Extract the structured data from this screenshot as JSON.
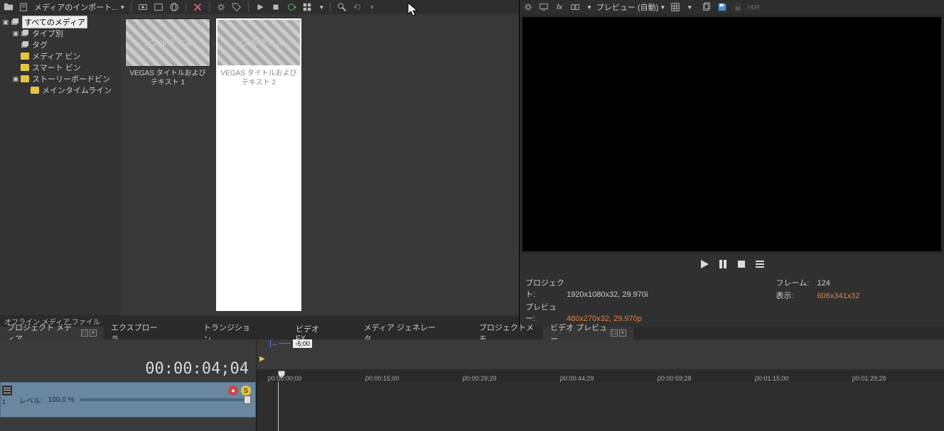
{
  "toolbar": {
    "import_label": "メディアのインポート..."
  },
  "tree": {
    "all_media": "すべてのメディア",
    "by_type": "タイプ別",
    "tags": "タグ",
    "media_bin": "メディア ビン",
    "smart_bin": "スマート ビン",
    "storyboard_bin": "ストーリーボードビン",
    "main_timeline": "メインタイムライン"
  },
  "media": {
    "items": [
      {
        "thumb_text": "ンプル テキス",
        "caption": "VEGAS タイトルおよびテキスト 1"
      },
      {
        "thumb_text": "ンプル テキス",
        "caption": "VEGAS タイトルおよびテキスト 2"
      }
    ]
  },
  "offline_label": "オフライン メディア ファイル",
  "tabs": {
    "project_media": "プロジェクト メディア",
    "explorer": "エクスプローラ",
    "transitions": "トランジション",
    "video_fx": "ビデオ FX",
    "media_generators": "メディア ジェネレータ",
    "project_notes": "プロジェクトメモ",
    "video_preview": "ビデオ プレビュー"
  },
  "preview": {
    "quality_label": "プレビュー (自動)",
    "project_label": "プロジェクト:",
    "project_val": "1920x1080x32, 29.970i",
    "preview_label": "プレビュー:",
    "preview_val": "480x270x32, 29.970p",
    "frame_label": "フレーム:",
    "frame_val": "124",
    "display_label": "表示:",
    "display_val": "606x341x32"
  },
  "timeline": {
    "timecode": "00:00:04;04",
    "marker_label": "-5;00",
    "ticks": [
      "00:00:00;00",
      "00:00:15;00",
      "00:00:29;29",
      "00:00:44;29",
      "00:00:59;28",
      "00:01:15;00",
      "00:01:29;29"
    ],
    "track": {
      "level_label": "レベル:",
      "level_val": "100.0 %"
    }
  }
}
